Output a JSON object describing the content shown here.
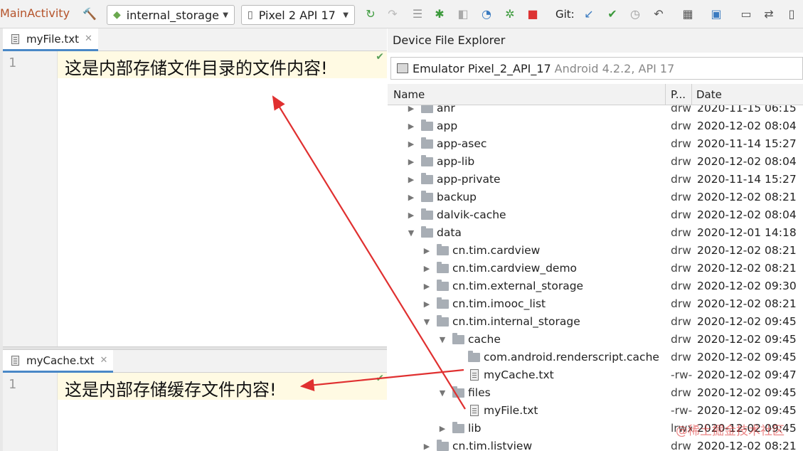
{
  "toolbar": {
    "run_config": "MainActivity",
    "module_combo": "internal_storage",
    "device_combo": "Pixel 2 API 17",
    "git_label": "Git:"
  },
  "editor_top": {
    "tab_label": "myFile.txt",
    "line_number": "1",
    "content": "这是内部存储文件目录的文件内容!"
  },
  "editor_bottom": {
    "tab_label": "myCache.txt",
    "line_number": "1",
    "content": "这是内部存储缓存文件内容!"
  },
  "explorer": {
    "title": "Device File Explorer",
    "device_name": "Emulator Pixel_2_API_17",
    "device_detail": "Android 4.2.2, API 17",
    "columns": {
      "name": "Name",
      "perm": "P...",
      "date": "Date"
    },
    "rows": [
      {
        "name": "anr",
        "perm": "drw",
        "date": "2020-11-15 06:15",
        "kind": "folder",
        "depth": 0,
        "expander": "right"
      },
      {
        "name": "app",
        "perm": "drw",
        "date": "2020-12-02 08:04",
        "kind": "folder",
        "depth": 0,
        "expander": "right"
      },
      {
        "name": "app-asec",
        "perm": "drw",
        "date": "2020-11-14 15:27",
        "kind": "folder",
        "depth": 0,
        "expander": "right"
      },
      {
        "name": "app-lib",
        "perm": "drw",
        "date": "2020-12-02 08:04",
        "kind": "folder",
        "depth": 0,
        "expander": "right"
      },
      {
        "name": "app-private",
        "perm": "drw",
        "date": "2020-11-14 15:27",
        "kind": "folder",
        "depth": 0,
        "expander": "right"
      },
      {
        "name": "backup",
        "perm": "drw",
        "date": "2020-12-02 08:21",
        "kind": "folder",
        "depth": 0,
        "expander": "right"
      },
      {
        "name": "dalvik-cache",
        "perm": "drw",
        "date": "2020-12-02 08:04",
        "kind": "folder",
        "depth": 0,
        "expander": "right"
      },
      {
        "name": "data",
        "perm": "drw",
        "date": "2020-12-01 14:18",
        "kind": "folder",
        "depth": 0,
        "expander": "down"
      },
      {
        "name": "cn.tim.cardview",
        "perm": "drw",
        "date": "2020-12-02 08:21",
        "kind": "folder",
        "depth": 1,
        "expander": "right"
      },
      {
        "name": "cn.tim.cardview_demo",
        "perm": "drw",
        "date": "2020-12-02 08:21",
        "kind": "folder",
        "depth": 1,
        "expander": "right"
      },
      {
        "name": "cn.tim.external_storage",
        "perm": "drw",
        "date": "2020-12-02 09:30",
        "kind": "folder",
        "depth": 1,
        "expander": "right"
      },
      {
        "name": "cn.tim.imooc_list",
        "perm": "drw",
        "date": "2020-12-02 08:21",
        "kind": "folder",
        "depth": 1,
        "expander": "right"
      },
      {
        "name": "cn.tim.internal_storage",
        "perm": "drw",
        "date": "2020-12-02 09:45",
        "kind": "folder",
        "depth": 1,
        "expander": "down"
      },
      {
        "name": "cache",
        "perm": "drw",
        "date": "2020-12-02 09:45",
        "kind": "folder",
        "depth": 2,
        "expander": "down"
      },
      {
        "name": "com.android.renderscript.cache",
        "perm": "drw",
        "date": "2020-12-02 09:45",
        "kind": "folder",
        "depth": 3,
        "expander": "none"
      },
      {
        "name": "myCache.txt",
        "perm": "-rw-",
        "date": "2020-12-02 09:47",
        "kind": "file",
        "depth": 3,
        "expander": "none"
      },
      {
        "name": "files",
        "perm": "drw",
        "date": "2020-12-02 09:45",
        "kind": "folder",
        "depth": 2,
        "expander": "down"
      },
      {
        "name": "myFile.txt",
        "perm": "-rw-",
        "date": "2020-12-02 09:45",
        "kind": "file",
        "depth": 3,
        "expander": "none"
      },
      {
        "name": "lib",
        "perm": "lrwx",
        "date": "2020-12-02 09:45",
        "kind": "link",
        "depth": 2,
        "expander": "right"
      },
      {
        "name": "cn.tim.listview",
        "perm": "drw",
        "date": "2020-12-02 08:21",
        "kind": "folder",
        "depth": 1,
        "expander": "right"
      }
    ]
  },
  "watermark": "@稀土掘金技术社区",
  "colors": {
    "accent": "#4a88c7",
    "annotation_arrow": "#e03030",
    "line_highlight": "#fffae3"
  }
}
